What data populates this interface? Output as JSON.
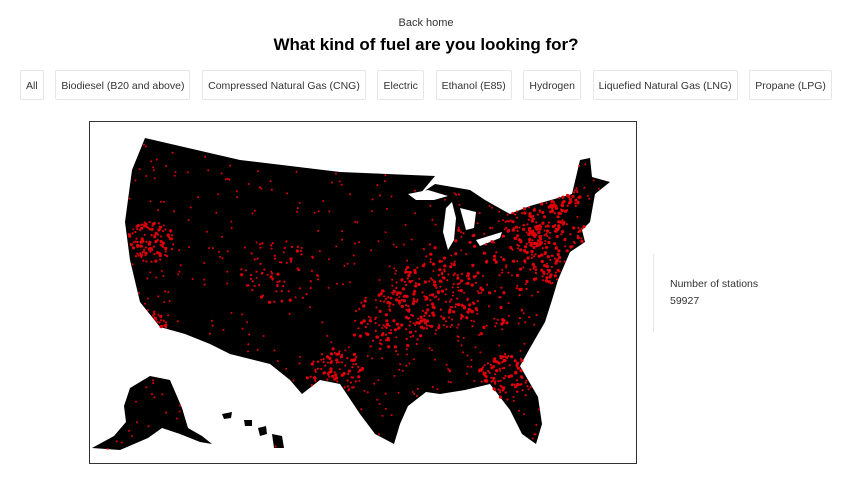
{
  "nav": {
    "back_label": "Back home"
  },
  "page": {
    "title": "What kind of fuel are you looking for?"
  },
  "filters": [
    {
      "label": "All"
    },
    {
      "label": "Biodiesel (B20 and above)"
    },
    {
      "label": "Compressed Natural Gas (CNG)"
    },
    {
      "label": "Electric"
    },
    {
      "label": "Ethanol (E85)"
    },
    {
      "label": "Hydrogen"
    },
    {
      "label": "Liquefied Natural Gas (LNG)"
    },
    {
      "label": "Propane (LPG)"
    }
  ],
  "stats": {
    "label": "Number of stations",
    "value": "59927"
  },
  "map": {
    "land_color": "#000000",
    "station_color": "#e0000a",
    "background": "#ffffff"
  }
}
